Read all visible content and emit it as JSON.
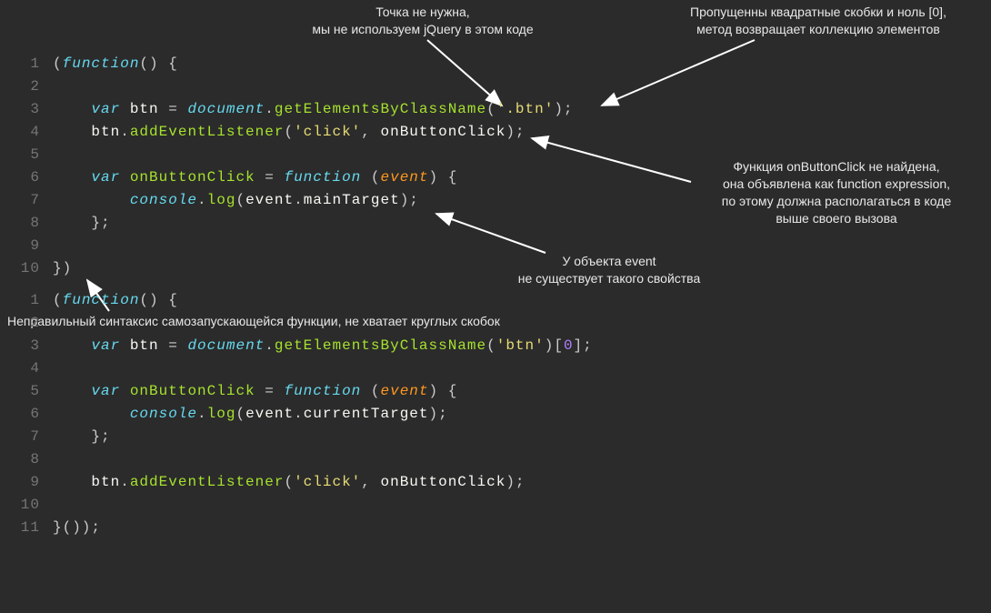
{
  "annotations": {
    "a1": "Точка не нужна,\nмы не используем jQuery в этом коде",
    "a2": "Пропущенны квадратные скобки и ноль [0],\nметод возвращает коллекцию элементов",
    "a3": "Функция onButtonClick не найдена,\nона объявлена как function expression,\nпо этому должна располагаться в коде\nвыше своего вызова",
    "a4": "У объекта event\nне существует такого свойства",
    "a5": "Неправильный синтаксис самозапускающейся функции, не хватает круглых скобок"
  },
  "block1": {
    "lines": [
      {
        "n": "1",
        "tokens": [
          [
            "pun",
            "("
          ],
          [
            "kw",
            "function"
          ],
          [
            "pun",
            "() {"
          ]
        ]
      },
      {
        "n": "2",
        "tokens": []
      },
      {
        "n": "3",
        "tokens": [
          [
            "pun",
            "    "
          ],
          [
            "kw",
            "var"
          ],
          [
            "pun",
            " "
          ],
          [
            "var",
            "btn"
          ],
          [
            "pun",
            " = "
          ],
          [
            "obj",
            "document"
          ],
          [
            "pun",
            "."
          ],
          [
            "fn",
            "getElementsByClassName"
          ],
          [
            "pun",
            "("
          ],
          [
            "str",
            "'.btn'"
          ],
          [
            "pun",
            ");"
          ]
        ]
      },
      {
        "n": "4",
        "tokens": [
          [
            "pun",
            "    "
          ],
          [
            "var",
            "btn"
          ],
          [
            "pun",
            "."
          ],
          [
            "fn",
            "addEventListener"
          ],
          [
            "pun",
            "("
          ],
          [
            "str",
            "'click'"
          ],
          [
            "pun",
            ", "
          ],
          [
            "var",
            "onButtonClick"
          ],
          [
            "pun",
            ");"
          ]
        ]
      },
      {
        "n": "5",
        "tokens": []
      },
      {
        "n": "6",
        "tokens": [
          [
            "pun",
            "    "
          ],
          [
            "kw",
            "var"
          ],
          [
            "pun",
            " "
          ],
          [
            "fn",
            "onButtonClick"
          ],
          [
            "pun",
            " = "
          ],
          [
            "kw",
            "function"
          ],
          [
            "pun",
            " ("
          ],
          [
            "arg",
            "event"
          ],
          [
            "pun",
            ") {"
          ]
        ]
      },
      {
        "n": "7",
        "tokens": [
          [
            "pun",
            "        "
          ],
          [
            "obj",
            "console"
          ],
          [
            "pun",
            "."
          ],
          [
            "fn",
            "log"
          ],
          [
            "pun",
            "("
          ],
          [
            "var",
            "event"
          ],
          [
            "pun",
            "."
          ],
          [
            "var",
            "mainTarget"
          ],
          [
            "pun",
            ");"
          ]
        ]
      },
      {
        "n": "8",
        "tokens": [
          [
            "pun",
            "    };"
          ]
        ]
      },
      {
        "n": "9",
        "tokens": []
      },
      {
        "n": "10",
        "tokens": [
          [
            "pun",
            "})"
          ]
        ]
      }
    ]
  },
  "block2": {
    "lines": [
      {
        "n": "1",
        "tokens": [
          [
            "pun",
            "("
          ],
          [
            "kw",
            "function"
          ],
          [
            "pun",
            "() {"
          ]
        ]
      },
      {
        "n": "2",
        "tokens": []
      },
      {
        "n": "3",
        "tokens": [
          [
            "pun",
            "    "
          ],
          [
            "kw",
            "var"
          ],
          [
            "pun",
            " "
          ],
          [
            "var",
            "btn"
          ],
          [
            "pun",
            " = "
          ],
          [
            "obj",
            "document"
          ],
          [
            "pun",
            "."
          ],
          [
            "fn",
            "getElementsByClassName"
          ],
          [
            "pun",
            "("
          ],
          [
            "str",
            "'btn'"
          ],
          [
            "pun",
            ")["
          ],
          [
            "num",
            "0"
          ],
          [
            "pun",
            "];"
          ]
        ]
      },
      {
        "n": "4",
        "tokens": []
      },
      {
        "n": "5",
        "tokens": [
          [
            "pun",
            "    "
          ],
          [
            "kw",
            "var"
          ],
          [
            "pun",
            " "
          ],
          [
            "fn",
            "onButtonClick"
          ],
          [
            "pun",
            " = "
          ],
          [
            "kw",
            "function"
          ],
          [
            "pun",
            " ("
          ],
          [
            "arg",
            "event"
          ],
          [
            "pun",
            ") {"
          ]
        ]
      },
      {
        "n": "6",
        "tokens": [
          [
            "pun",
            "        "
          ],
          [
            "obj",
            "console"
          ],
          [
            "pun",
            "."
          ],
          [
            "fn",
            "log"
          ],
          [
            "pun",
            "("
          ],
          [
            "var",
            "event"
          ],
          [
            "pun",
            "."
          ],
          [
            "var",
            "currentTarget"
          ],
          [
            "pun",
            ");"
          ]
        ]
      },
      {
        "n": "7",
        "tokens": [
          [
            "pun",
            "    };"
          ]
        ]
      },
      {
        "n": "8",
        "tokens": []
      },
      {
        "n": "9",
        "tokens": [
          [
            "pun",
            "    "
          ],
          [
            "var",
            "btn"
          ],
          [
            "pun",
            "."
          ],
          [
            "fn",
            "addEventListener"
          ],
          [
            "pun",
            "("
          ],
          [
            "str",
            "'click'"
          ],
          [
            "pun",
            ", "
          ],
          [
            "var",
            "onButtonClick"
          ],
          [
            "pun",
            ");"
          ]
        ]
      },
      {
        "n": "10",
        "tokens": []
      },
      {
        "n": "11",
        "tokens": [
          [
            "pun",
            "}());"
          ]
        ]
      }
    ]
  }
}
